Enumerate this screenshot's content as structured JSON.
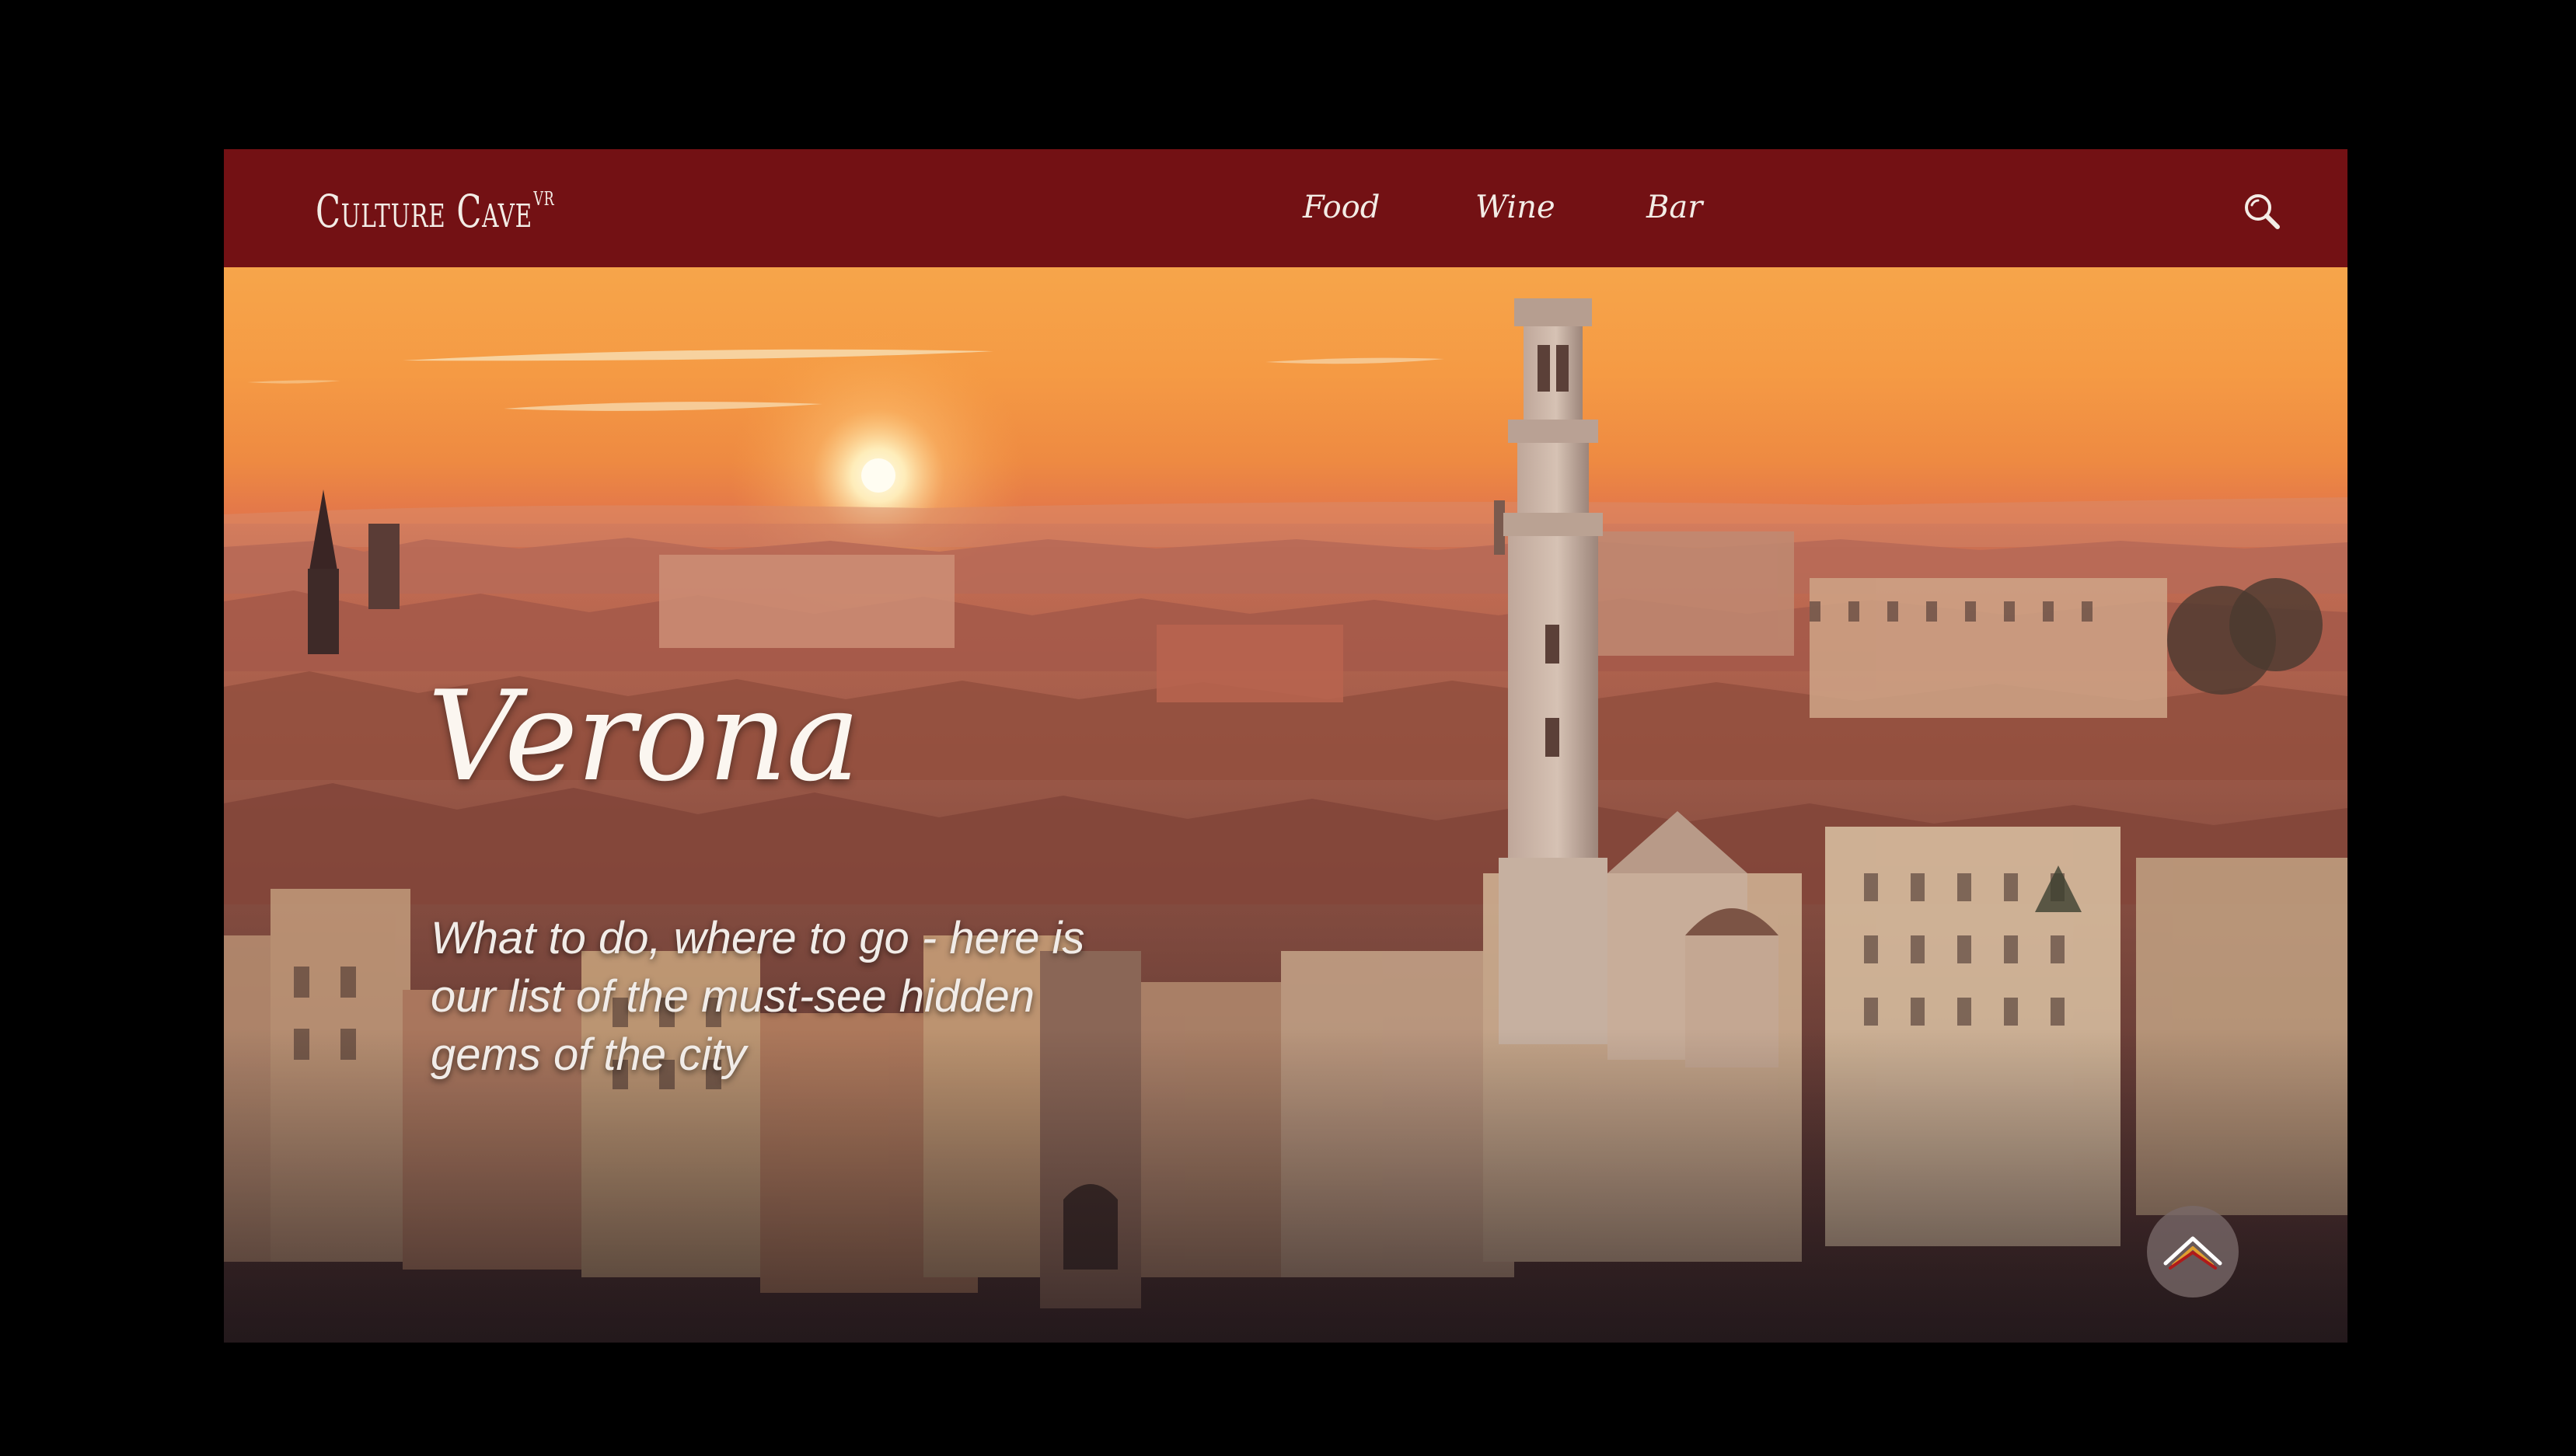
{
  "brand": {
    "name": "Culture Cave",
    "superscript": "VR"
  },
  "nav": {
    "items": [
      {
        "label": "Food"
      },
      {
        "label": "Wine"
      },
      {
        "label": "Bar"
      }
    ],
    "search_icon": "search-icon"
  },
  "hero": {
    "title": "Verona",
    "subtitle": "What to do, where to go - here is our list of the must-see hidden gems of the city",
    "scroll_top_icon": "chevron-up-icon"
  },
  "colors": {
    "navbar": "#731114",
    "sky_top": "#f6a54a",
    "text_light": "#f3ece6"
  }
}
